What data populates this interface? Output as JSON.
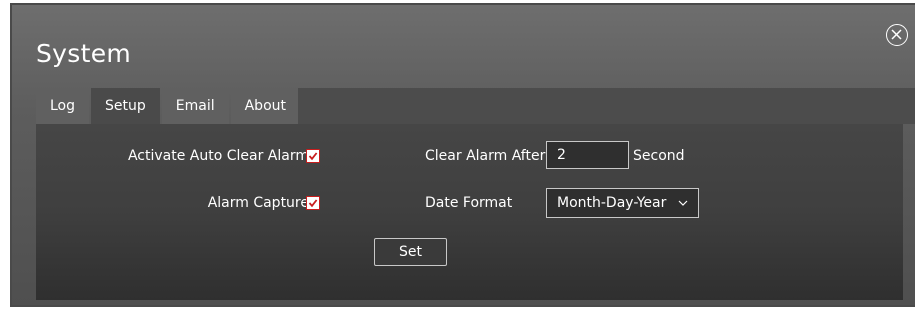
{
  "window": {
    "title": "System",
    "close_icon": "close-circle-icon"
  },
  "tabs": [
    {
      "label": "Log",
      "active": false
    },
    {
      "label": "Setup",
      "active": true
    },
    {
      "label": "Email",
      "active": false
    },
    {
      "label": "About",
      "active": false
    }
  ],
  "setup": {
    "auto_clear": {
      "label": "Activate Auto Clear Alarm",
      "checked": true
    },
    "alarm_capture": {
      "label": "Alarm Capture",
      "checked": true
    },
    "clear_after": {
      "label": "Clear Alarm After",
      "value": "2",
      "unit": "Second"
    },
    "date_format": {
      "label": "Date Format",
      "value": "Month-Day-Year",
      "icon": "chevron-down-icon"
    },
    "set_label": "Set"
  },
  "colors": {
    "checkbox_accent": "#c81d1d",
    "text": "#ffffff"
  }
}
